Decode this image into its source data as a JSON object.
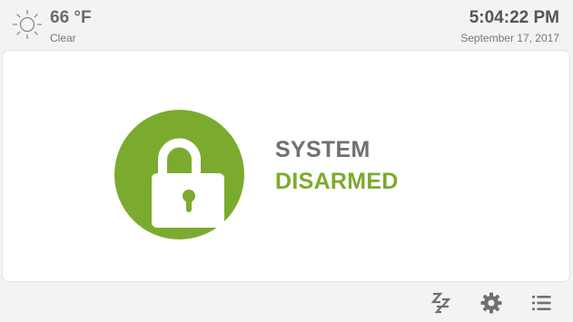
{
  "weather": {
    "temperature": "66 °F",
    "condition": "Clear",
    "icon": "sun-icon"
  },
  "clock": {
    "time": "5:04:22 PM",
    "date": "September 17, 2017"
  },
  "status": {
    "line1": "SYSTEM",
    "line2": "DISARMED",
    "icon": "lock-icon",
    "accent_color": "#7bab2e",
    "text_color": "#707070"
  },
  "footer": {
    "buttons": [
      {
        "name": "sleep",
        "icon": "sleep-icon"
      },
      {
        "name": "settings",
        "icon": "gear-icon"
      },
      {
        "name": "menu",
        "icon": "list-icon"
      }
    ]
  }
}
